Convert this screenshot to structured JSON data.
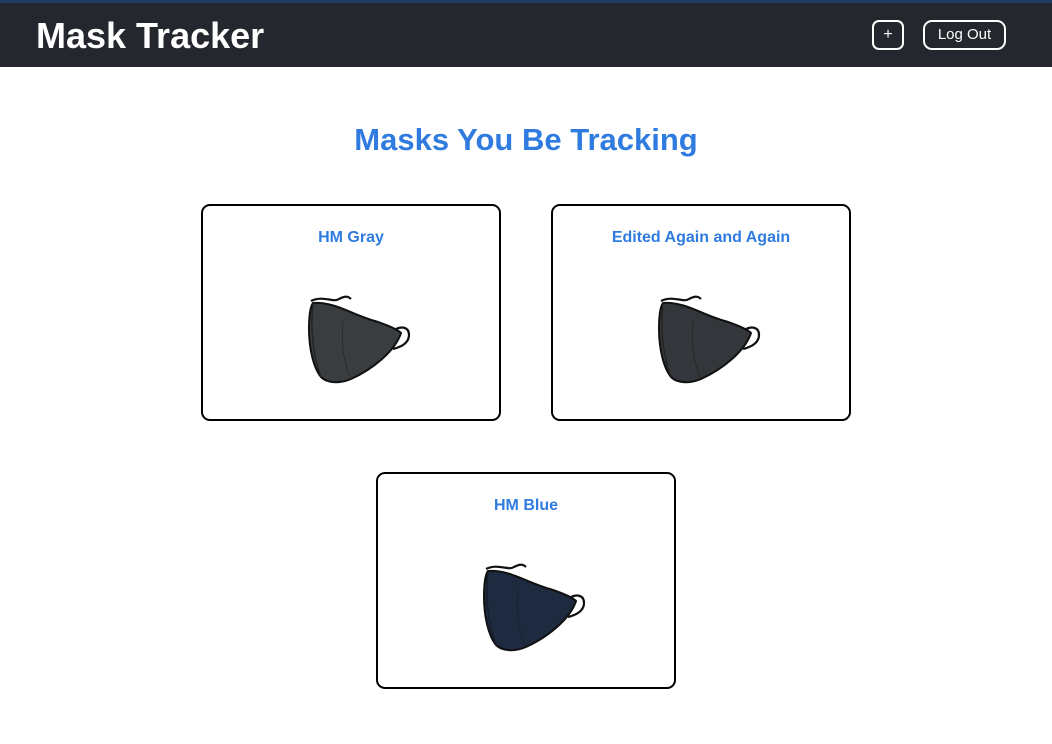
{
  "navbar": {
    "brand": "Mask Tracker",
    "add_label": "+",
    "logout_label": "Log Out"
  },
  "main": {
    "title": "Masks You Be Tracking",
    "masks": [
      {
        "name": "HM Gray",
        "image_icon": "face-mask-image",
        "color": "#3a3d40"
      },
      {
        "name": "Edited Again and Again",
        "image_icon": "face-mask-image",
        "color": "#33373b"
      },
      {
        "name": "HM Blue",
        "image_icon": "face-mask-image",
        "color": "#1e2a40"
      }
    ]
  }
}
